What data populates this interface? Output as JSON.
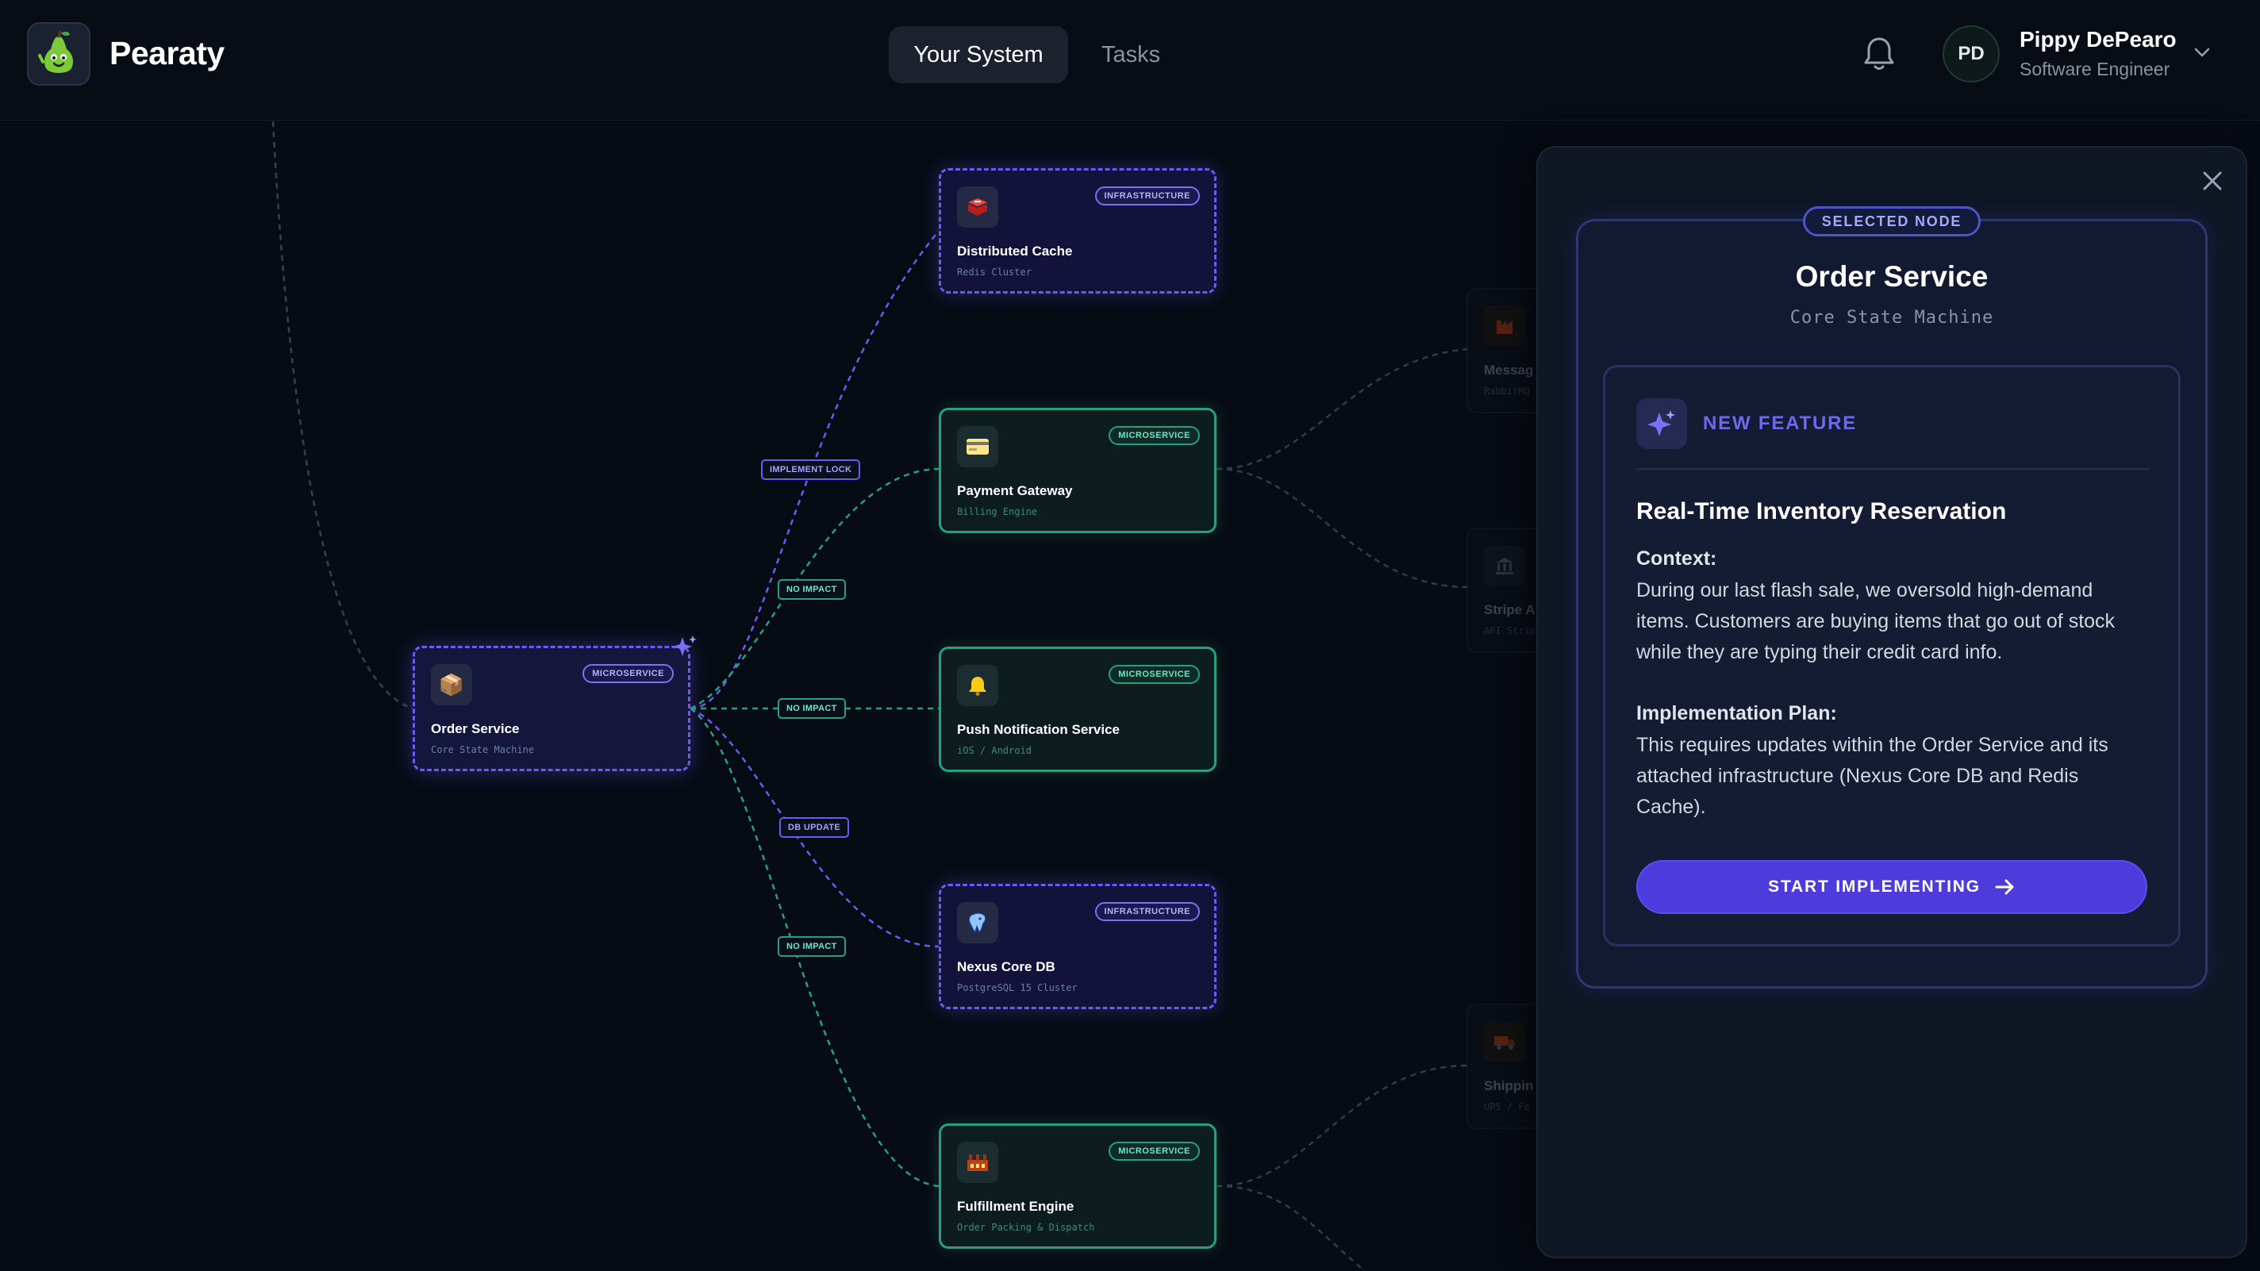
{
  "app": {
    "name": "Pearaty"
  },
  "nav": {
    "tabs": [
      {
        "label": "Your System",
        "active": true
      },
      {
        "label": "Tasks",
        "active": false
      }
    ]
  },
  "user": {
    "initials": "PD",
    "name": "Pippy DePearo",
    "role": "Software Engineer"
  },
  "graph": {
    "nodes": {
      "order": {
        "title": "Order Service",
        "subtitle": "Core State Machine",
        "badge": "MICROSERVICE",
        "icon": "package-icon"
      },
      "cache": {
        "title": "Distributed Cache",
        "subtitle": "Redis Cluster",
        "badge": "INFRASTRUCTURE",
        "icon": "redis-cube-icon"
      },
      "payment": {
        "title": "Payment Gateway",
        "subtitle": "Billing Engine",
        "badge": "MICROSERVICE",
        "icon": "credit-card-icon"
      },
      "push": {
        "title": "Push Notification Service",
        "subtitle": "iOS / Android",
        "badge": "MICROSERVICE",
        "icon": "bell-icon"
      },
      "db": {
        "title": "Nexus Core DB",
        "subtitle": "PostgreSQL 15 Cluster",
        "badge": "INFRASTRUCTURE",
        "icon": "database-elephant-icon"
      },
      "fulfillment": {
        "title": "Fulfillment Engine",
        "subtitle": "Order Packing & Dispatch",
        "badge": "MICROSERVICE",
        "icon": "factory-icon"
      }
    },
    "ghost_nodes": {
      "message": {
        "title": "Messag",
        "subtitle": "RabbitMQ"
      },
      "stripe": {
        "title": "Stripe A",
        "subtitle": "API Strip"
      },
      "shipping": {
        "title": "Shippin",
        "subtitle": "UPS / Fe"
      }
    },
    "edge_labels": {
      "lock": "IMPLEMENT LOCK",
      "no_impact_1": "NO IMPACT",
      "no_impact_2": "NO IMPACT",
      "db_update": "DB UPDATE",
      "no_impact_3": "NO IMPACT"
    }
  },
  "panel": {
    "pill": "SELECTED NODE",
    "title": "Order Service",
    "subtitle": "Core State Machine",
    "feature": {
      "tag": "NEW FEATURE",
      "title": "Real-Time Inventory Reservation",
      "context_label": "Context:",
      "context_text": "During our last flash sale, we oversold high-demand items. Customers are buying items that go out of stock while they are typing their credit card info.",
      "plan_label": "Implementation Plan:",
      "plan_text": "This requires updates within the Order Service and its attached infrastructure (Nexus Core DB and Redis Cache).",
      "cta": "START IMPLEMENTING"
    }
  },
  "colors": {
    "background": "#070b14",
    "purple": "#6a5cf0",
    "green": "#24a27e",
    "cta": "#4d3bdc"
  }
}
